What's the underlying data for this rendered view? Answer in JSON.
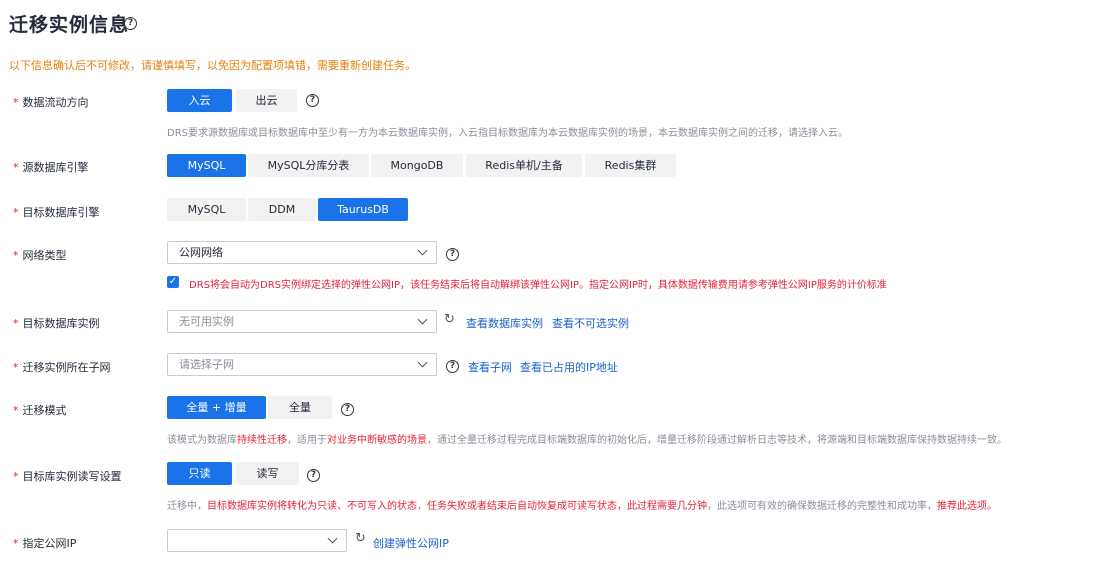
{
  "page": {
    "title": "迁移实例信息",
    "notice": "以下信息确认后不可修改，请谨慎填写，以免因为配置项填错，需要重新创建任务。"
  },
  "fields": {
    "direction": {
      "label": "数据流动方向",
      "options": [
        "入云",
        "出云"
      ],
      "selected": "入云",
      "desc": "DRS要求源数据库或目标数据库中至少有一方为本云数据库实例，入云指目标数据库为本云数据库实例的场景，本云数据库实例之间的迁移，请选择入云。"
    },
    "source_engine": {
      "label": "源数据库引擎",
      "options": [
        "MySQL",
        "MySQL分库分表",
        "MongoDB",
        "Redis单机/主备",
        "Redis集群"
      ],
      "selected": "MySQL"
    },
    "target_engine": {
      "label": "目标数据库引擎",
      "options": [
        "MySQL",
        "DDM",
        "TaurusDB"
      ],
      "selected": "TaurusDB"
    },
    "network": {
      "label": "网络类型",
      "value": "公网网络",
      "checkbox_checked": true,
      "checkbox_text": "DRS将会自动为DRS实例绑定选择的弹性公网IP，该任务结束后将自动解绑该弹性公网IP。指定公网IP时，具体数据传输费用请参考弹性公网IP服务的计价标准"
    },
    "target_instance": {
      "label": "目标数据库实例",
      "placeholder": "无可用实例",
      "link1": "查看数据库实例",
      "link2": "查看不可选实例"
    },
    "subnet": {
      "label": "迁移实例所在子网",
      "placeholder": "请选择子网",
      "link1": "查看子网",
      "link2": "查看已占用的IP地址"
    },
    "mode": {
      "label": "迁移模式",
      "options": [
        "全量 + 增量",
        "全量"
      ],
      "selected": "全量 + 增量",
      "desc": {
        "p1": "该模式为数据库",
        "r1": "持续性迁移",
        "p2": "，适用于",
        "r2": "对业务中断敏感的场景",
        "p3": "，通过全量迁移过程完成目标端数据库的初始化后，增量迁移阶段通过解析日志等技术，将源端和目标端数据库保持数据持续一致。"
      }
    },
    "rw": {
      "label": "目标库实例读写设置",
      "options": [
        "只读",
        "读写"
      ],
      "selected": "只读",
      "desc": {
        "p1": "迁移中，",
        "r1": "目标数据库实例将转化为只读、不可写入的状态",
        "p2": "，",
        "r2": "任务失败或者结束后自动恢复成可读写状态，此过程需要几分钟",
        "p3": "，此选项可有效的确保数据迁移的完整性和成功率，",
        "r3": "推荐此选项。"
      }
    },
    "public_ip": {
      "label": "指定公网IP",
      "value": "",
      "link1": "创建弹性公网IP"
    }
  },
  "colors": {
    "primary": "#1a73e8",
    "required": "#e5243b",
    "notice": "#e58010",
    "link": "#1a63c6"
  }
}
